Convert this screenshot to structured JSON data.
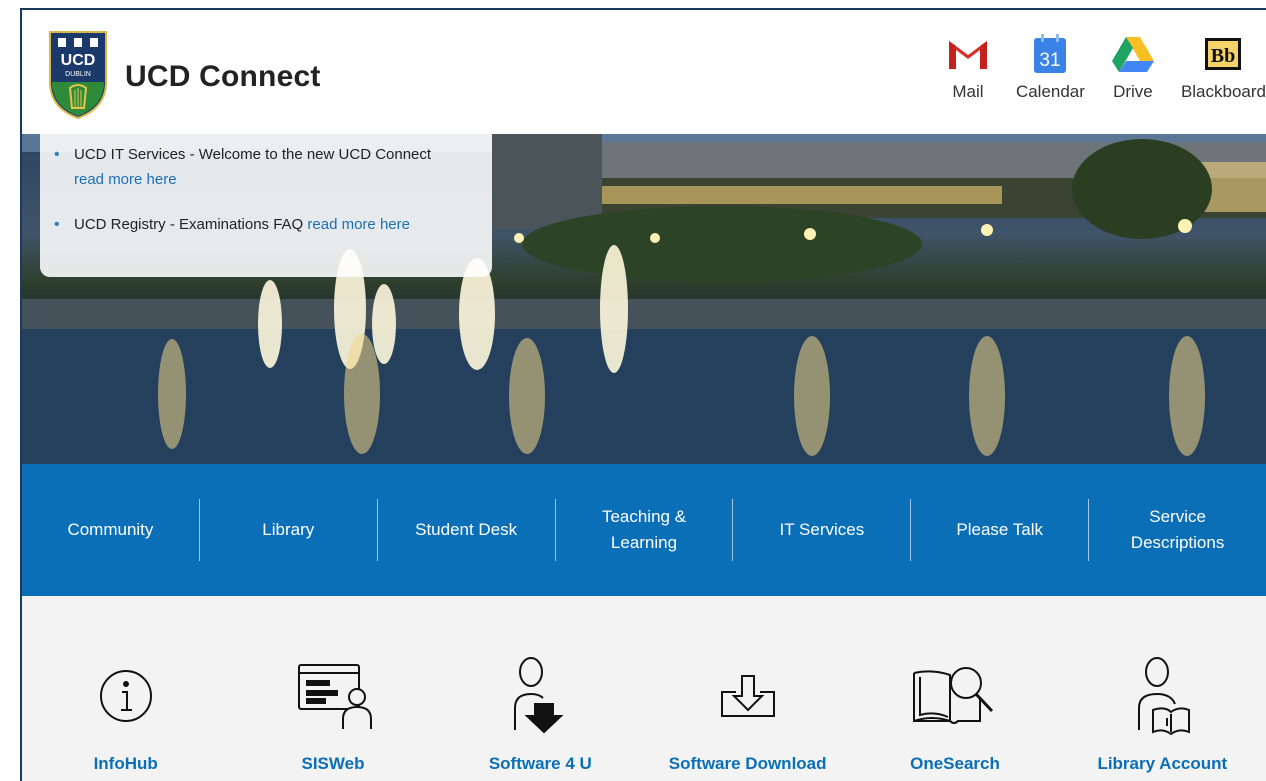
{
  "header": {
    "logo_text": [
      "UCD",
      "DUBLIN"
    ],
    "title": "UCD Connect",
    "apps": [
      {
        "label": "Mail",
        "icon": "gmail-icon"
      },
      {
        "label": "Calendar",
        "icon": "calendar-icon",
        "badge": "31"
      },
      {
        "label": "Drive",
        "icon": "drive-icon"
      },
      {
        "label": "Blackboard",
        "icon": "blackboard-icon",
        "badge": "Bb"
      }
    ]
  },
  "news": {
    "items": [
      {
        "text": "UCD IT Services - Welcome to the new UCD Connect",
        "link": "read more here"
      },
      {
        "text": "UCD Registry - Examinations FAQ",
        "link": "read more here"
      }
    ]
  },
  "nav": {
    "items": [
      "Community",
      "Library",
      "Student Desk",
      "Teaching & Learning",
      "IT Services",
      "Please Talk",
      "Service Descriptions"
    ]
  },
  "quick_links": {
    "items": [
      {
        "label": "InfoHub",
        "icon": "info-icon"
      },
      {
        "label": "SISWeb",
        "icon": "sisweb-icon"
      },
      {
        "label": "Software 4 U",
        "icon": "software-user-icon"
      },
      {
        "label": "Software Download",
        "icon": "download-icon"
      },
      {
        "label": "OneSearch",
        "icon": "book-search-icon"
      },
      {
        "label": "Library Account",
        "icon": "library-account-icon"
      }
    ]
  },
  "colors": {
    "brand_blue": "#0a6fb7",
    "link_blue": "#1d6fb6",
    "background": "#f3f3f3"
  }
}
